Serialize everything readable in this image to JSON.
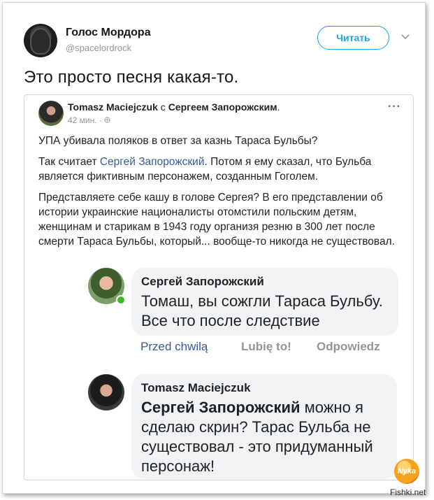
{
  "tweet": {
    "author_name": "Голос Мордора",
    "author_handle": "@spacelordrock",
    "follow_label": "Читать",
    "text": "Это просто песня какая-то."
  },
  "post": {
    "author": "Tomasz Maciejczuk",
    "with_prefix": " с ",
    "with_name": "Сергеем Запорожским",
    "with_suffix": ".",
    "time": "42 мин. · ",
    "more_label": "···",
    "p1": "УПА убивала поляков в ответ за казнь Тараса Бульбы?",
    "p2_before": "Так считает ",
    "p2_link": "Сергей Запорожский",
    "p2_after": ". Потом я ему сказал, что Бульба является фиктивным персонажем, созданным Гоголем.",
    "p3": "Представляете себе кашу в голове Сергея? В его представлении об истории украинские националисты отомстили польским детям, женщинам и старикам в 1943 году организя резню в 300 лет после смерти Тараса Бульбы, который... вообще-то никогда не существовал."
  },
  "comments": [
    {
      "author": "Сергей Запорожский",
      "text": "Томаш, вы сожгли Тараса Бульбу. Все что после следствие",
      "time": "Przed chwilą",
      "like": "Lubię to!",
      "reply": "Odpowiedz"
    },
    {
      "author": "Tomasz Maciejczuk",
      "mention": "Сергей Запорожский",
      "text": " можно я сделаю скрин? Тарас Бульба не существовал - это придуманный персонаж!"
    }
  ],
  "watermark": {
    "logo_text": "Nyka",
    "site": "Fishki.net"
  },
  "colors": {
    "twitter_blue": "#1da1f2",
    "fb_link": "#365899",
    "online_green": "#42b72a"
  }
}
